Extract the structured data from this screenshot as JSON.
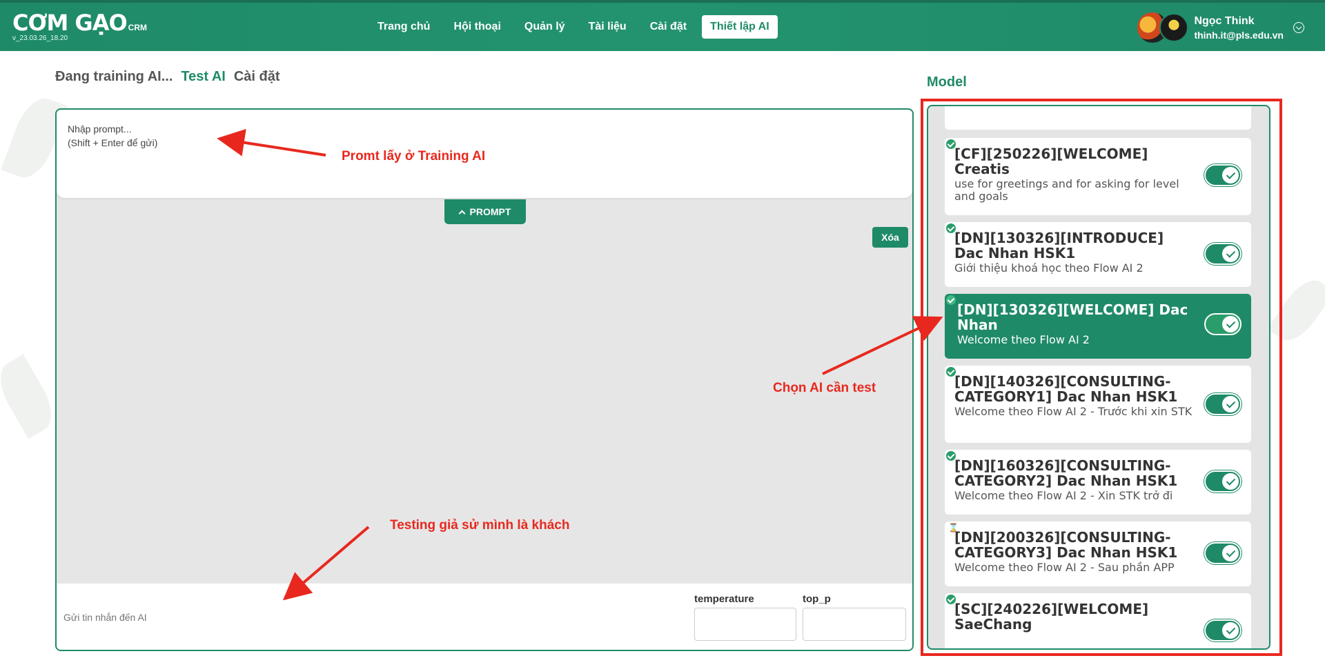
{
  "header": {
    "logo": "CƠM GẠO",
    "logo_suffix": "CRM",
    "version": "v_23.03.26_18.20",
    "nav": [
      {
        "label": "Trang chủ",
        "active": false
      },
      {
        "label": "Hội thoại",
        "active": false
      },
      {
        "label": "Quản lý",
        "active": false
      },
      {
        "label": "Tài liệu",
        "active": false
      },
      {
        "label": "Cài đặt",
        "active": false
      },
      {
        "label": "Thiết lập AI",
        "active": true
      }
    ],
    "user": {
      "name": "Ngọc Think",
      "email": "thinh.it@pls.edu.vn"
    }
  },
  "tabs": [
    {
      "label": "Đang training AI...",
      "active": false
    },
    {
      "label": "Test AI",
      "active": true
    },
    {
      "label": "Cài đặt",
      "active": false
    }
  ],
  "chat": {
    "prompt_placeholder_line1": "Nhập prompt...",
    "prompt_placeholder_line2": "(Shift + Enter để gửi)",
    "prompt_button": "PROMPT",
    "clear_button": "Xóa",
    "message_placeholder": "Gửi tin nhắn đến AI",
    "temperature_label": "temperature",
    "top_p_label": "top_p"
  },
  "model": {
    "title": "Model",
    "items": [
      {
        "title": "[CF][250226][WELCOME] Creatis",
        "desc": "use for greetings and for asking for level and goals",
        "status": "done",
        "enabled": true,
        "selected": false
      },
      {
        "title": "[DN][130326][INTRODUCE] Dac Nhan HSK1",
        "desc": "Giới thiệu khoá học theo Flow AI 2",
        "status": "done",
        "enabled": true,
        "selected": false
      },
      {
        "title": "[DN][130326][WELCOME] Dac Nhan",
        "desc": "Welcome theo Flow AI 2",
        "status": "done",
        "enabled": true,
        "selected": true
      },
      {
        "title": "[DN][140326][CONSULTING-CATEGORY1] Dac Nhan HSK1",
        "desc": "Welcome theo Flow AI 2 - Trước khi xin STK",
        "status": "done",
        "enabled": true,
        "selected": false
      },
      {
        "title": "[DN][160326][CONSULTING-CATEGORY2] Dac Nhan HSK1",
        "desc": "Welcome theo Flow AI 2 - Xin STK trở đi",
        "status": "done",
        "enabled": true,
        "selected": false
      },
      {
        "title": "[DN][200326][CONSULTING-CATEGORY3] Dac Nhan HSK1",
        "desc": "Welcome theo Flow AI 2 - Sau phần APP",
        "status": "pending",
        "enabled": true,
        "selected": false
      },
      {
        "title": "[SC][240226][WELCOME] SaeChang",
        "desc": "",
        "status": "done",
        "enabled": true,
        "selected": false
      }
    ]
  },
  "annotations": {
    "prompt_note": "Promt lấy ở Training AI",
    "choose_note": "Chọn AI cần test",
    "testing_note": "Testing giả sử mình là khách",
    "color": "#e8281e"
  },
  "colors": {
    "brand": "#1f8a68",
    "annotation": "#e8281e"
  }
}
